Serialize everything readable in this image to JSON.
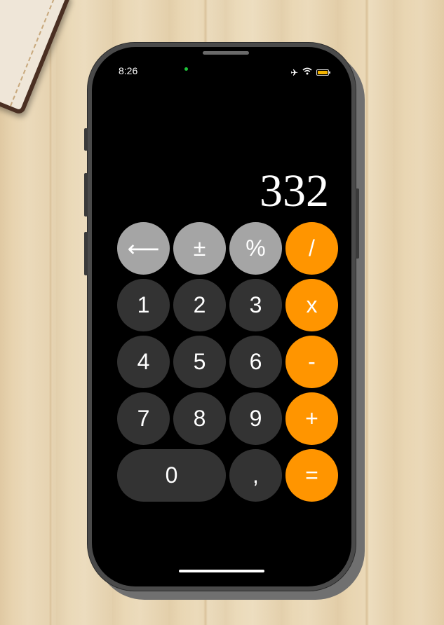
{
  "status_bar": {
    "time": "8:26",
    "icons": [
      "airplane-icon",
      "wifi-icon",
      "battery-icon"
    ],
    "battery_color": "#f4b400"
  },
  "display": {
    "value": "332"
  },
  "colors": {
    "function_key": "#a5a5a5",
    "number_key": "#333333",
    "operator_key": "#ff9500",
    "screen": "#000000"
  },
  "keys": {
    "backspace": "⟵",
    "plus_minus": "±",
    "percent": "%",
    "divide": "/",
    "one": "1",
    "two": "2",
    "three": "3",
    "multiply": "x",
    "four": "4",
    "five": "5",
    "six": "6",
    "subtract": "-",
    "seven": "7",
    "eight": "8",
    "nine": "9",
    "add": "+",
    "zero": "0",
    "decimal": ",",
    "equals": "="
  }
}
